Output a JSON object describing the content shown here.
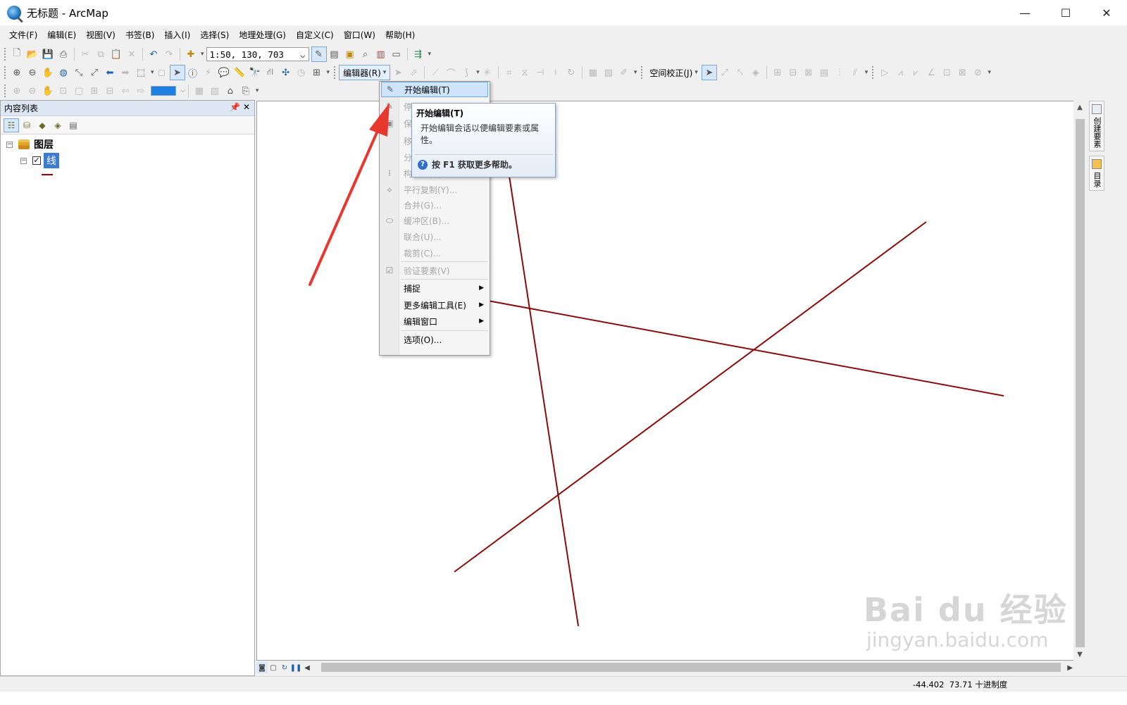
{
  "window": {
    "title": "无标题 - ArcMap",
    "minimize": "—",
    "maximize": "☐",
    "close": "✕"
  },
  "menubar": [
    "文件(F)",
    "编辑(E)",
    "视图(V)",
    "书签(B)",
    "插入(I)",
    "选择(S)",
    "地理处理(G)",
    "自定义(C)",
    "窗口(W)",
    "帮助(H)"
  ],
  "standard_toolbar": {
    "scale_value": "1:50, 130, 703",
    "scale_arrow": "⌵"
  },
  "editor_toolbar": {
    "editor_label": "编辑器(R)",
    "dropdown": "▾"
  },
  "spatial_adjust": {
    "label": "空间校正(J)",
    "dropdown": "▾"
  },
  "toc": {
    "title": "内容列表",
    "pin": "ᵖ",
    "close": "✕",
    "root": {
      "label": "图层",
      "expander": "−"
    },
    "layer": {
      "label": "线",
      "expander": "−",
      "check": "✓",
      "color": "#a00000"
    }
  },
  "edit_menu": {
    "items": [
      {
        "label": "开始编辑(T)",
        "icon": "pencil-icon",
        "enabled": true,
        "highlighted": true
      },
      {
        "label": "停",
        "icon": "stop-edit-icon",
        "enabled": false
      },
      {
        "label": "保",
        "icon": "save-edits-icon",
        "enabled": false
      },
      {
        "label": "移",
        "icon": "",
        "enabled": false
      },
      {
        "label": "分",
        "icon": "",
        "enabled": false
      },
      {
        "label": "构造点(O)...",
        "icon": "construct-points-icon",
        "enabled": false
      },
      {
        "label": "平行复制(Y)...",
        "icon": "copy-parallel-icon",
        "enabled": false
      },
      {
        "label": "合并(G)...",
        "icon": "",
        "enabled": false
      },
      {
        "label": "缓冲区(B)...",
        "icon": "buffer-icon",
        "enabled": false
      },
      {
        "label": "联合(U)...",
        "icon": "",
        "enabled": false
      },
      {
        "label": "裁剪(C)...",
        "icon": "",
        "enabled": false
      },
      {
        "label": "验证要素(V)",
        "icon": "validate-icon",
        "enabled": false
      },
      {
        "label": "捕捉",
        "icon": "",
        "enabled": true,
        "submenu": true
      },
      {
        "label": "更多编辑工具(E)",
        "icon": "",
        "enabled": true,
        "submenu": true
      },
      {
        "label": "编辑窗口",
        "icon": "",
        "enabled": true,
        "submenu": true
      },
      {
        "label": "选项(O)...",
        "icon": "",
        "enabled": true
      }
    ],
    "submenu_arrow": "▶"
  },
  "tooltip": {
    "title": "开始编辑(T)",
    "body": "开始编辑会话以便编辑要素或属性。",
    "help": "按 F1 获取更多帮助。",
    "help_icon": "?"
  },
  "map": {
    "line_color": "#8b0a0a",
    "features_count_hint": "3 polylines"
  },
  "right_dock": {
    "tab1": "创建要素",
    "tab2": "目录"
  },
  "status": {
    "x": "-44.402",
    "y": "73.71",
    "units": "十进制度"
  },
  "watermark": {
    "top": "Bai du 经验",
    "bottom": "jingyan.baidu.com"
  },
  "annotation": {
    "arrow_color": "#e8372f"
  }
}
